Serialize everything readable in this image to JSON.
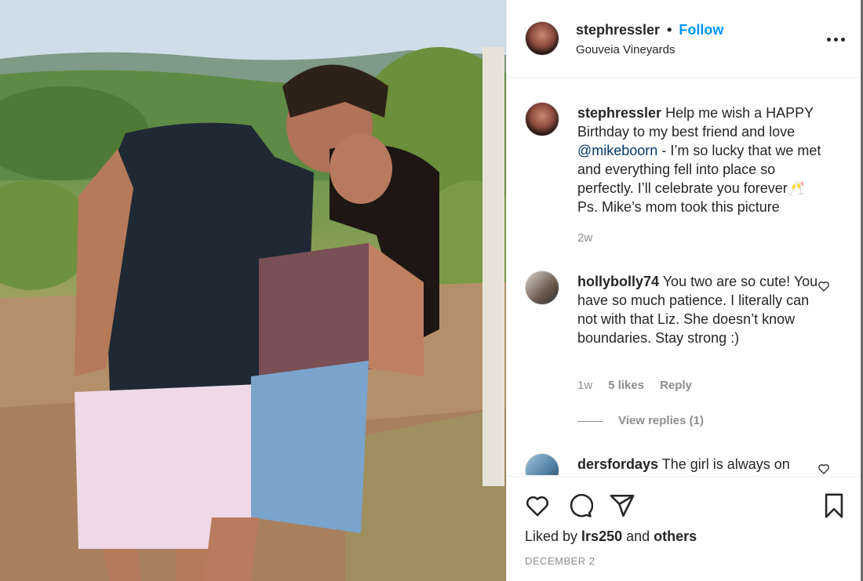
{
  "post": {
    "photo_alt": "Couple kissing in a vineyard",
    "header": {
      "username": "stephressler",
      "separator": "•",
      "follow_label": "Follow",
      "location": "Gouveia Vineyards",
      "more_icon": "more-horizontal-icon"
    },
    "caption": {
      "username": "stephressler",
      "text_before": " Help me wish a HAPPY Birthday to my best friend and love ",
      "mention": "@mikeboorn",
      "text_after": " - I’m so lucky that we met and everything fell into place so perfectly. I’ll celebrate you forever🥂 Ps. Mike’s mom took this picture",
      "time": "2w"
    },
    "comments": [
      {
        "username": "hollybolly74",
        "text": " You two are so cute! You have so much patience. I literally can not with that Liz. She doesn’t know boundaries. Stay strong :)",
        "time": "1w",
        "likes": "5 likes",
        "reply_label": "Reply",
        "view_replies": "View replies (1)"
      },
      {
        "username": "dersfordays",
        "text": " The girl is always on"
      }
    ],
    "actions": {
      "like_icon": "heart-icon",
      "comment_icon": "comment-icon",
      "share_icon": "share-icon",
      "save_icon": "bookmark-icon"
    },
    "liked_by": {
      "prefix": "Liked by ",
      "user": "lrs250",
      "middle": " and ",
      "others": "others"
    },
    "date": "DECEMBER 2"
  }
}
